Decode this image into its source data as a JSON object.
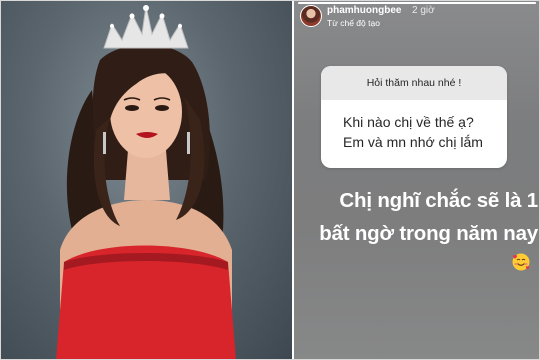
{
  "story": {
    "username": "phamhuongbee",
    "time": "2 giờ",
    "subtitle": "Từ chế độ tạo",
    "progress": 1.0,
    "question": {
      "title": "Hỏi thăm nhau nhé !",
      "text": "Khi nào chị về thế ạ? Em và mn nhớ chị lắm"
    },
    "answer": {
      "line1": "Chị nghĩ chắc sẽ là 1",
      "line2": "bất ngờ trong năm nay"
    },
    "emoji": "smiling-face-with-hearts"
  },
  "photo": {
    "subject": "woman-wearing-crown-red-dress"
  },
  "colors": {
    "dress": "#d8252b",
    "crown": "#e6e6e6",
    "story_bg": "#7d7e7f"
  }
}
